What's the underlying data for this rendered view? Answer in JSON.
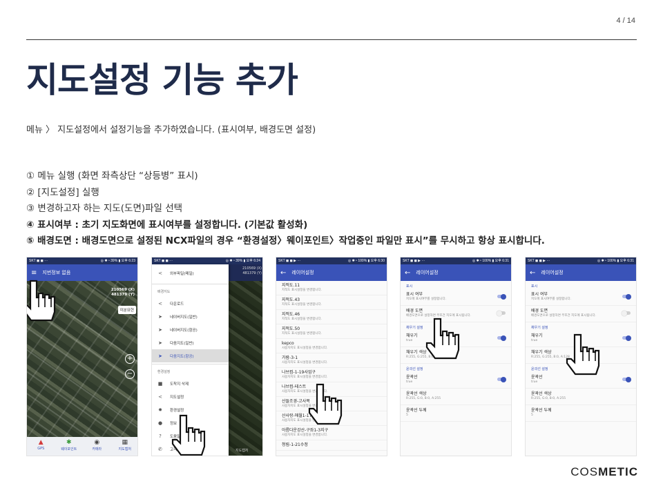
{
  "page_number": "4 / 14",
  "title": "지도설정 기능 추가",
  "intro": "메뉴 〉 지도설정에서 설정기능을 추가하였습니다. (표시여부, 배경도면 설정)",
  "steps": [
    "①  메뉴 실행 (화면 좌측상단 “상등병” 표시)",
    "②  [지도설정] 실행",
    "③  변경하고자 하는 지도(도면)파일 선택",
    "④  표시여부 : 초기 지도화면에 표시여부를 설정합니다. (기본값 활성화)",
    "⑤  배경도면 : 배경도면으로 설정된 NCX파일의 경우 “환경설정〉웨이포인트〉작업중인 파일만 표시”를 무시하고 항상 표시합니다."
  ],
  "brand": {
    "prefix": "COS",
    "suffix": "METIC"
  },
  "phone1": {
    "status_left": "SKT ◼ ◼ ···",
    "status_right": "◎ ✱ ⁿ 39% ▮ 오후 6:23",
    "menu_icon": "hamburger-icon",
    "appbar_title": "지번정보 없음",
    "coord_x": "210569 (X)",
    "coord_y": "481379 (Y)",
    "map_button": "미분묘현",
    "zoom_in": "+",
    "zoom_out": "−",
    "tabs": [
      {
        "icon": "▲",
        "label": "GPS"
      },
      {
        "icon": "✱",
        "label": "웨이포인트"
      },
      {
        "icon": "◉",
        "label": "카메라"
      },
      {
        "icon": "▦",
        "label": "지도캡처"
      }
    ]
  },
  "phone2": {
    "status_left": "SKT ◼ ◼ ···",
    "status_right": "◎ ✱ ⁿ 39% ▮ 오후 6:24",
    "dim_coords": "210569 (X)\n481379 (Y)",
    "top_item": "외부파일(메일)",
    "section1": "배경지도",
    "maps": [
      "다운로드",
      "네이버지도(일반)",
      "네이버지도(항공)",
      "다음지도(일반)",
      "다음지도(항공)"
    ],
    "section2": "환경설정",
    "settings": [
      "도착지 삭제",
      "지도설정",
      "환경설정",
      "정보",
      "도움말",
      "고객센터"
    ],
    "dim_tab": "지도캡처"
  },
  "phone3": {
    "status_left": "SKT ◼ ◼ ▶ ···",
    "status_right": "◎ ✱ ⁿ 100% ▮ 오후 6:30",
    "title": "레이어설정",
    "items": [
      {
        "t": "지적도.11",
        "s": "지적도 표시설정을 변경합니다."
      },
      {
        "t": "지적도.43",
        "s": "지적도 표시설정을 변경합니다."
      },
      {
        "t": "지적도.46",
        "s": "지적도 표시설정을 변경합니다."
      },
      {
        "t": "지적도.50",
        "s": "지적도 표시설정을 변경합니다."
      },
      {
        "t": "kepco",
        "s": "사용자지도 표시설정을 변경합니다."
      },
      {
        "t": "가람-3-1",
        "s": "사용자지도 표시설정을 변경합니다."
      },
      {
        "t": "나브컴-1-19사업구",
        "s": "사용자지도 표시설정을 변경합니다."
      },
      {
        "t": "나브컴-테스트",
        "s": "사용자지도 표시설정을 변경합니다."
      },
      {
        "t": "산들조경-고사목",
        "s": "사용자지도 표시설정을 변경합니다."
      },
      {
        "t": "산사랑-애월1-17,18",
        "s": "사용자지도 표시설정을 변경합니다."
      },
      {
        "t": "아름다운강산-구좌1-3지구",
        "s": "사용자지도 표시설정을 변경합니다."
      },
      {
        "t": "청림-1-21수정",
        "s": ""
      }
    ]
  },
  "phone4": {
    "status_left": "SKT ◼ ◼ ▶ ···",
    "status_right": "◎ ✱ ⁿ 100% ▮ 오후 6:31",
    "title": "레이어설정",
    "sec_display": "표시",
    "show_title": "표시 여부",
    "show_sub": "지도에 표시여부를 설정합니다.",
    "bg_title": "배경 도면",
    "bg_sub": "배경도면으로 설정하면 무조건 지도에 표시됩니다.",
    "sec_fill": "채우기 설정",
    "fill_title": "채우기",
    "fill_sub": "true",
    "fillc_title": "채우기 색상",
    "fillc_sub": "R:255, G:255, B:0, A:128",
    "sec_line": "윤곽선 설정",
    "line_title": "윤곽선",
    "line_sub": "true",
    "linec_title": "윤곽선 색상",
    "linec_sub": "R:255, G:0, B:0, A:255",
    "linew_title": "윤곽선 두께",
    "linew_sub": "5"
  },
  "phone5": {
    "status_left": "SKT ◼ ◼ ▶ ···",
    "status_right": "◎ ✱ ⁿ 100% ▮ 오후 6:31",
    "title": "레이어설정"
  }
}
